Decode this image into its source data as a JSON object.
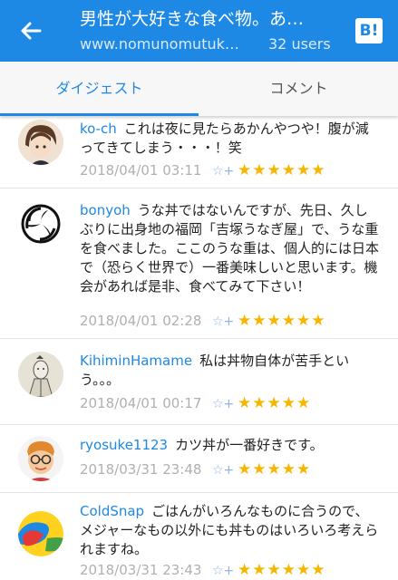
{
  "header": {
    "title": "男性が大好きな食べ物。あ…",
    "url": "www.nomunomutuk…",
    "users": "32 users",
    "hatena_logo": "B!",
    "back_icon": "arrow-left-icon",
    "accent_color": "#1e88e5"
  },
  "tabs": [
    {
      "label": "ダイジェスト",
      "active": true
    },
    {
      "label": "コメント",
      "active": false
    }
  ],
  "comments": [
    {
      "user": "ko-ch",
      "text": "これは夜に見たらあかんやつや！腹が減ってきてしまう・・・！笑",
      "date": "2018/04/01 03:11",
      "stars": "★★★★★★",
      "add_star": "☆+"
    },
    {
      "user": "bonyoh",
      "text": "うな丼ではないんですが、先日、久しぶりに出身地の福岡「吉塚うなぎ屋」で、うな重を食べました。ここのうな重は、個人的には日本で（恐らく世界で）一番美味しいと思います。機会があれば是非、食べてみて下さい！",
      "date": "2018/04/01 02:28",
      "stars": "★★★★★★",
      "add_star": "☆+"
    },
    {
      "user": "KihiminHamame",
      "text": "私は丼物自体が苦手という。。。",
      "date": "2018/04/01 00:17",
      "stars": "★★★★★",
      "add_star": "☆+"
    },
    {
      "user": "ryosuke1123",
      "text": "カツ丼が一番好きです。",
      "date": "2018/03/31 23:48",
      "stars": "★★★★★",
      "add_star": "☆+"
    },
    {
      "user": "ColdSnap",
      "text": "ごはんがいろんなものに合うので、メジャーなもの以外にも丼ものはいろいろ考えられますね。",
      "date": "2018/03/31 23:43",
      "stars": "★★★★★★",
      "add_star": "☆+"
    }
  ]
}
